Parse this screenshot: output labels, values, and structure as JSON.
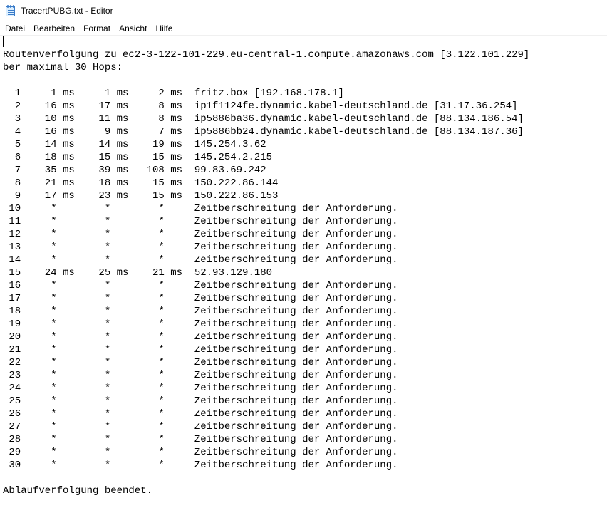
{
  "window": {
    "title": "TracertPUBG.txt - Editor"
  },
  "menu": {
    "items": [
      "Datei",
      "Bearbeiten",
      "Format",
      "Ansicht",
      "Hilfe"
    ]
  },
  "icons": {
    "app": "notepad-icon"
  },
  "document": {
    "lines": [
      "",
      "Routenverfolgung zu ec2-3-122-101-229.eu-central-1.compute.amazonaws.com [3.122.101.229]",
      "ber maximal 30 Hops:",
      "",
      "  1     1 ms     1 ms     2 ms  fritz.box [192.168.178.1]",
      "  2    16 ms    17 ms     8 ms  ip1f1124fe.dynamic.kabel-deutschland.de [31.17.36.254]",
      "  3    10 ms    11 ms     8 ms  ip5886ba36.dynamic.kabel-deutschland.de [88.134.186.54]",
      "  4    16 ms     9 ms     7 ms  ip5886bb24.dynamic.kabel-deutschland.de [88.134.187.36]",
      "  5    14 ms    14 ms    19 ms  145.254.3.62",
      "  6    18 ms    15 ms    15 ms  145.254.2.215",
      "  7    35 ms    39 ms   108 ms  99.83.69.242",
      "  8    21 ms    18 ms    15 ms  150.222.86.144",
      "  9    17 ms    23 ms    15 ms  150.222.86.153",
      " 10     *        *        *     Zeitberschreitung der Anforderung.",
      " 11     *        *        *     Zeitberschreitung der Anforderung.",
      " 12     *        *        *     Zeitberschreitung der Anforderung.",
      " 13     *        *        *     Zeitberschreitung der Anforderung.",
      " 14     *        *        *     Zeitberschreitung der Anforderung.",
      " 15    24 ms    25 ms    21 ms  52.93.129.180",
      " 16     *        *        *     Zeitberschreitung der Anforderung.",
      " 17     *        *        *     Zeitberschreitung der Anforderung.",
      " 18     *        *        *     Zeitberschreitung der Anforderung.",
      " 19     *        *        *     Zeitberschreitung der Anforderung.",
      " 20     *        *        *     Zeitberschreitung der Anforderung.",
      " 21     *        *        *     Zeitberschreitung der Anforderung.",
      " 22     *        *        *     Zeitberschreitung der Anforderung.",
      " 23     *        *        *     Zeitberschreitung der Anforderung.",
      " 24     *        *        *     Zeitberschreitung der Anforderung.",
      " 25     *        *        *     Zeitberschreitung der Anforderung.",
      " 26     *        *        *     Zeitberschreitung der Anforderung.",
      " 27     *        *        *     Zeitberschreitung der Anforderung.",
      " 28     *        *        *     Zeitberschreitung der Anforderung.",
      " 29     *        *        *     Zeitberschreitung der Anforderung.",
      " 30     *        *        *     Zeitberschreitung der Anforderung.",
      "",
      "Ablaufverfolgung beendet."
    ]
  }
}
